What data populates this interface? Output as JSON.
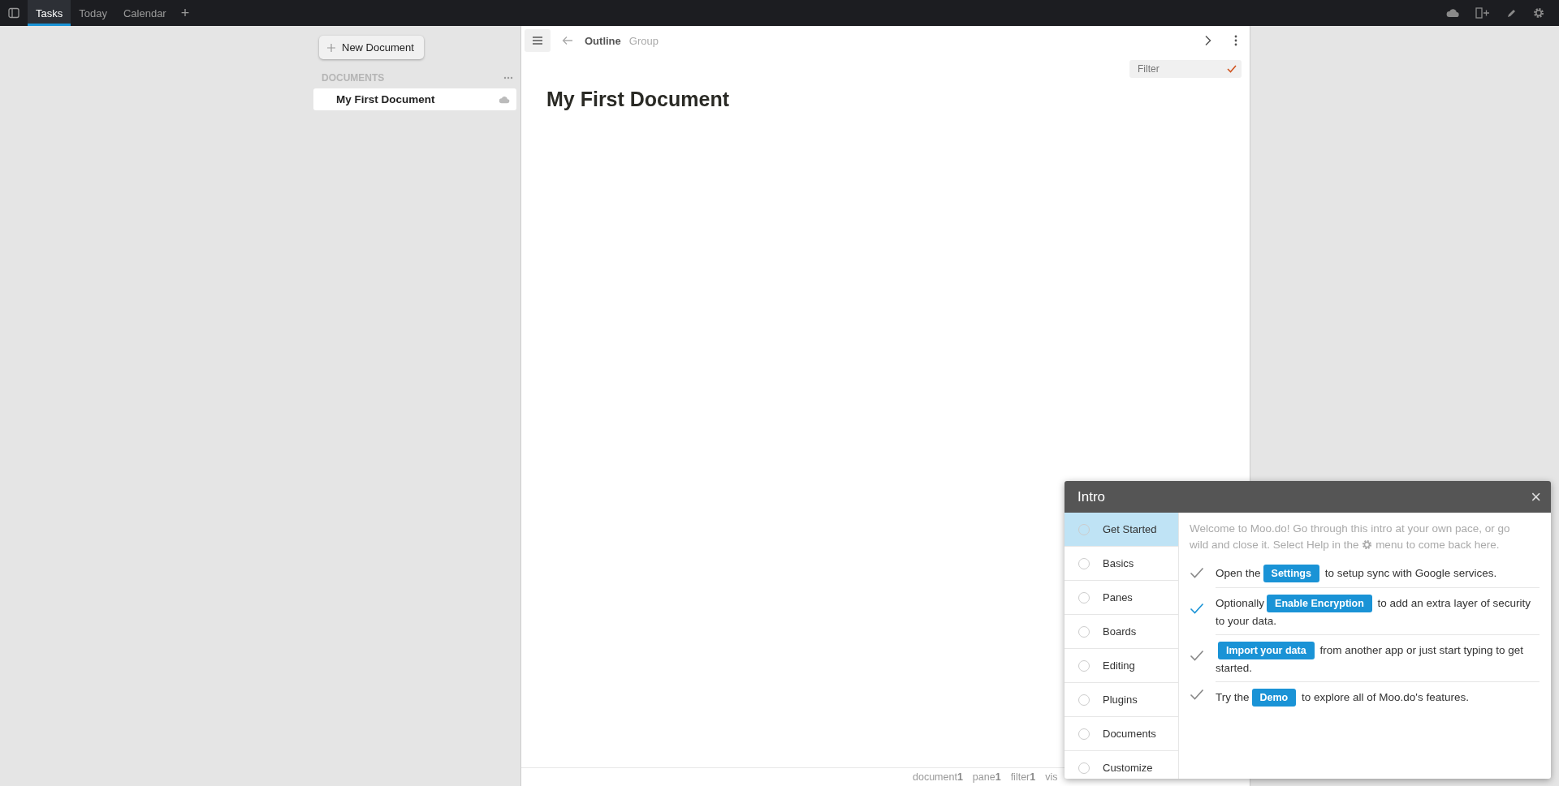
{
  "tabs": [
    {
      "label": "Tasks",
      "selected": true
    },
    {
      "label": "Today",
      "selected": false
    },
    {
      "label": "Calendar",
      "selected": false
    }
  ],
  "add_tab": "+",
  "sidebar": {
    "new_button": "New Document",
    "section": "DOCUMENTS",
    "items": [
      {
        "label": "My First Document",
        "selected": true
      }
    ]
  },
  "pane": {
    "views": [
      {
        "label": "Outline",
        "selected": true
      },
      {
        "label": "Group",
        "selected": false
      }
    ],
    "filter": {
      "placeholder": "Filter"
    },
    "title": "My First Document"
  },
  "status_bar": [
    {
      "label": "document",
      "value": "1"
    },
    {
      "label": "pane",
      "value": "1"
    },
    {
      "label": "filter",
      "value": "1"
    },
    {
      "label": "vis"
    }
  ],
  "intro": {
    "title": "Intro",
    "close": "×",
    "steps": [
      {
        "label": "Get Started",
        "selected": true
      },
      {
        "label": "Basics",
        "selected": false
      },
      {
        "label": "Panes",
        "selected": false
      },
      {
        "label": "Boards",
        "selected": false
      },
      {
        "label": "Editing",
        "selected": false
      },
      {
        "label": "Plugins",
        "selected": false
      },
      {
        "label": "Documents",
        "selected": false
      },
      {
        "label": "Customize",
        "selected": false
      }
    ],
    "welcome_before": "Welcome to Moo.do! Go through this intro at your own pace, or go wild and close it. Select Help in the",
    "welcome_after": "menu to come back here.",
    "tasks": [
      {
        "before": "Open the",
        "button": "Settings",
        "after": "to setup sync with Google services.",
        "checked": false
      },
      {
        "before": "Optionally",
        "button": "Enable Encryption",
        "after": "to add an extra layer of security to your data.",
        "checked": true
      },
      {
        "button": "Import your data",
        "after": "from another app or just start typing to get started.",
        "checked": false
      },
      {
        "before": "Try the",
        "button": "Demo",
        "after": "to explore all of Moo.do's features.",
        "checked": false
      }
    ]
  }
}
